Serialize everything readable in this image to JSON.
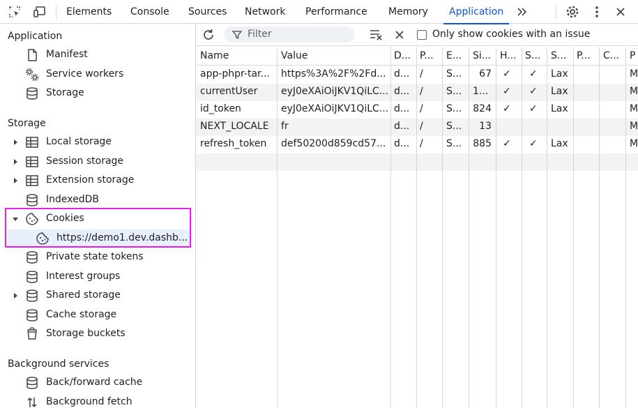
{
  "tabs": [
    "Elements",
    "Console",
    "Sources",
    "Network",
    "Performance",
    "Memory",
    "Application"
  ],
  "active_tab": "Application",
  "sidebar": {
    "application_heading": "Application",
    "application_items": [
      {
        "label": "Manifest",
        "icon": "document-icon"
      },
      {
        "label": "Service workers",
        "icon": "gears-icon"
      },
      {
        "label": "Storage",
        "icon": "database-icon"
      }
    ],
    "storage_heading": "Storage",
    "storage_items": [
      {
        "label": "Local storage",
        "icon": "table-icon",
        "expandable": true
      },
      {
        "label": "Session storage",
        "icon": "table-icon",
        "expandable": true
      },
      {
        "label": "Extension storage",
        "icon": "table-icon",
        "expandable": true
      },
      {
        "label": "IndexedDB",
        "icon": "database-icon",
        "expandable": false
      },
      {
        "label": "Cookies",
        "icon": "cookie-icon",
        "expanded": true
      },
      {
        "label": "https://demo1.dev.dashb...",
        "icon": "cookie-icon",
        "selected": true
      },
      {
        "label": "Private state tokens",
        "icon": "database-icon"
      },
      {
        "label": "Interest groups",
        "icon": "database-icon"
      },
      {
        "label": "Shared storage",
        "icon": "database-icon",
        "expandable": true
      },
      {
        "label": "Cache storage",
        "icon": "database-icon"
      },
      {
        "label": "Storage buckets",
        "icon": "bucket-icon"
      }
    ],
    "background_heading": "Background services",
    "background_items": [
      {
        "label": "Back/forward cache",
        "icon": "database-icon"
      },
      {
        "label": "Background fetch",
        "icon": "updown-arrows-icon"
      }
    ]
  },
  "toolbar": {
    "filter_placeholder": "Filter",
    "only_issue_label": "Only show cookies with an issue"
  },
  "table": {
    "headers": [
      "Name",
      "Value",
      "D...",
      "P...",
      "E...",
      "Si...",
      "H...",
      "S...",
      "S...",
      "P...",
      "C...",
      "P"
    ],
    "rows": [
      [
        "app-phpr-tar...",
        "https%3A%2F%2Fd...",
        "d...",
        "/",
        "S...",
        "67",
        "✓",
        "✓",
        "Lax",
        "",
        "",
        "M"
      ],
      [
        "currentUser",
        "eyJ0eXAiOiJKV1QiLC...",
        "d...",
        "/",
        "S...",
        "1...",
        "✓",
        "✓",
        "Lax",
        "",
        "",
        "M"
      ],
      [
        "id_token",
        "eyJ0eXAiOiJKV1QiLC...",
        "d...",
        "/",
        "S...",
        "824",
        "✓",
        "✓",
        "Lax",
        "",
        "",
        "M"
      ],
      [
        "NEXT_LOCALE",
        "fr",
        "d...",
        "/",
        "S...",
        "13",
        "",
        "",
        "",
        "",
        "",
        "M"
      ],
      [
        "refresh_token",
        "def50200d859cd57...",
        "d...",
        "/",
        "S...",
        "885",
        "✓",
        "✓",
        "Lax",
        "",
        "",
        "M"
      ]
    ]
  },
  "colors": {
    "accent": "#0b57d0",
    "highlight": "#e91ee9",
    "border": "#d3d6db",
    "row_alt": "#f1f3f4"
  }
}
